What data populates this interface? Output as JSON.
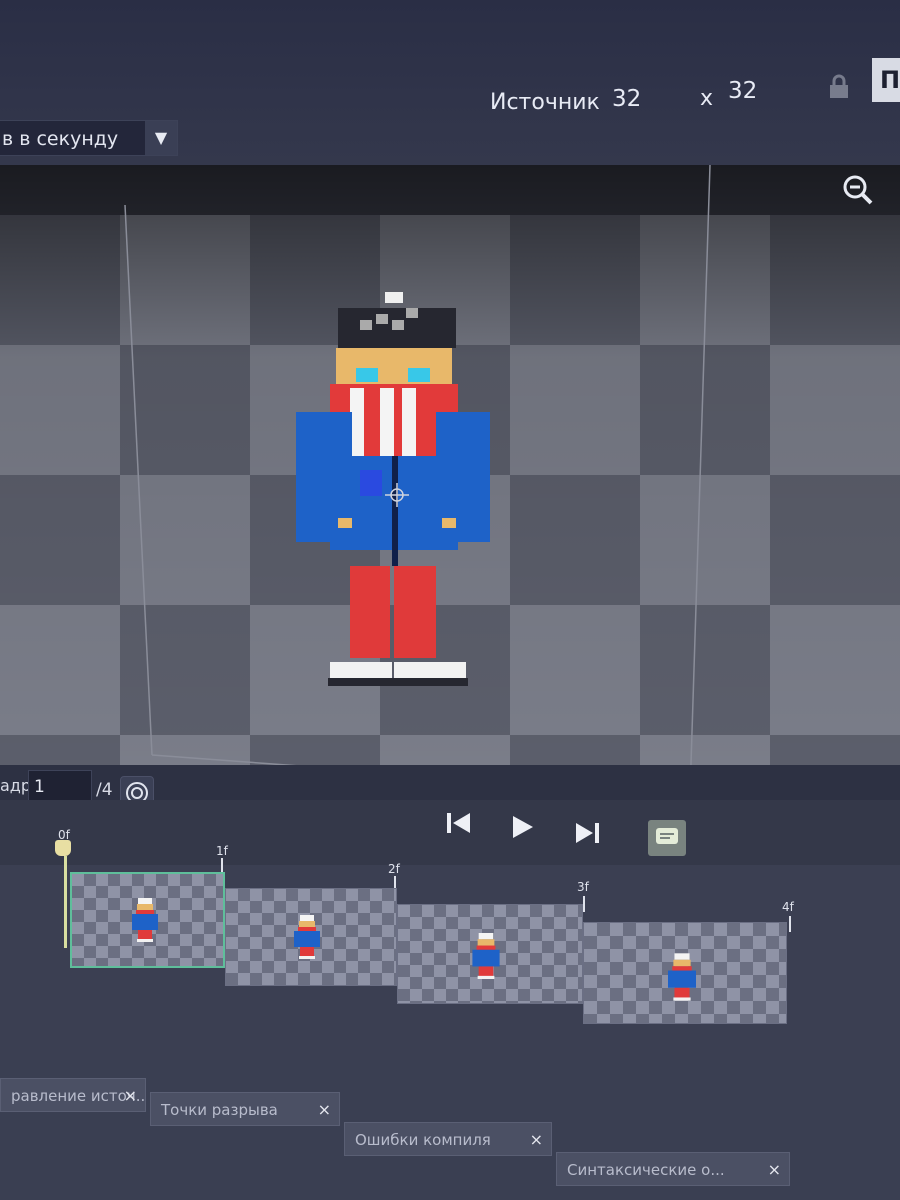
{
  "toolbar": {
    "fps_value": "в в секунду",
    "source_label": "Источник",
    "source_width": "32",
    "source_x": "x",
    "source_height": "32",
    "corner_button": "П"
  },
  "frame_controls": {
    "label": "адр:",
    "current_frame": "1",
    "total_frames": "/4"
  },
  "timeline": {
    "labels": [
      "0f",
      "1f",
      "2f",
      "3f",
      "4f"
    ]
  },
  "bottom_tabs": [
    {
      "label": "равление источ...",
      "close": "×"
    },
    {
      "label": "Точки разрыва",
      "close": "×"
    },
    {
      "label": "Ошибки компиля",
      "close": "×"
    },
    {
      "label": "Синтаксические о...",
      "close": "×"
    }
  ],
  "icons": {
    "dropdown": "chevron-down-icon",
    "lock": "lock-icon",
    "zoom": "zoom-out-icon",
    "onion": "onion-skin-icon",
    "first": "skip-back-icon",
    "play": "play-icon",
    "last": "skip-forward-icon",
    "subtitle": "subtitle-icon"
  },
  "colors": {
    "hood": "#1e62c8",
    "pants": "#e03a3a",
    "skin": "#e8b86a",
    "eye": "#38c8e8",
    "selection": "#5fbf9b"
  }
}
